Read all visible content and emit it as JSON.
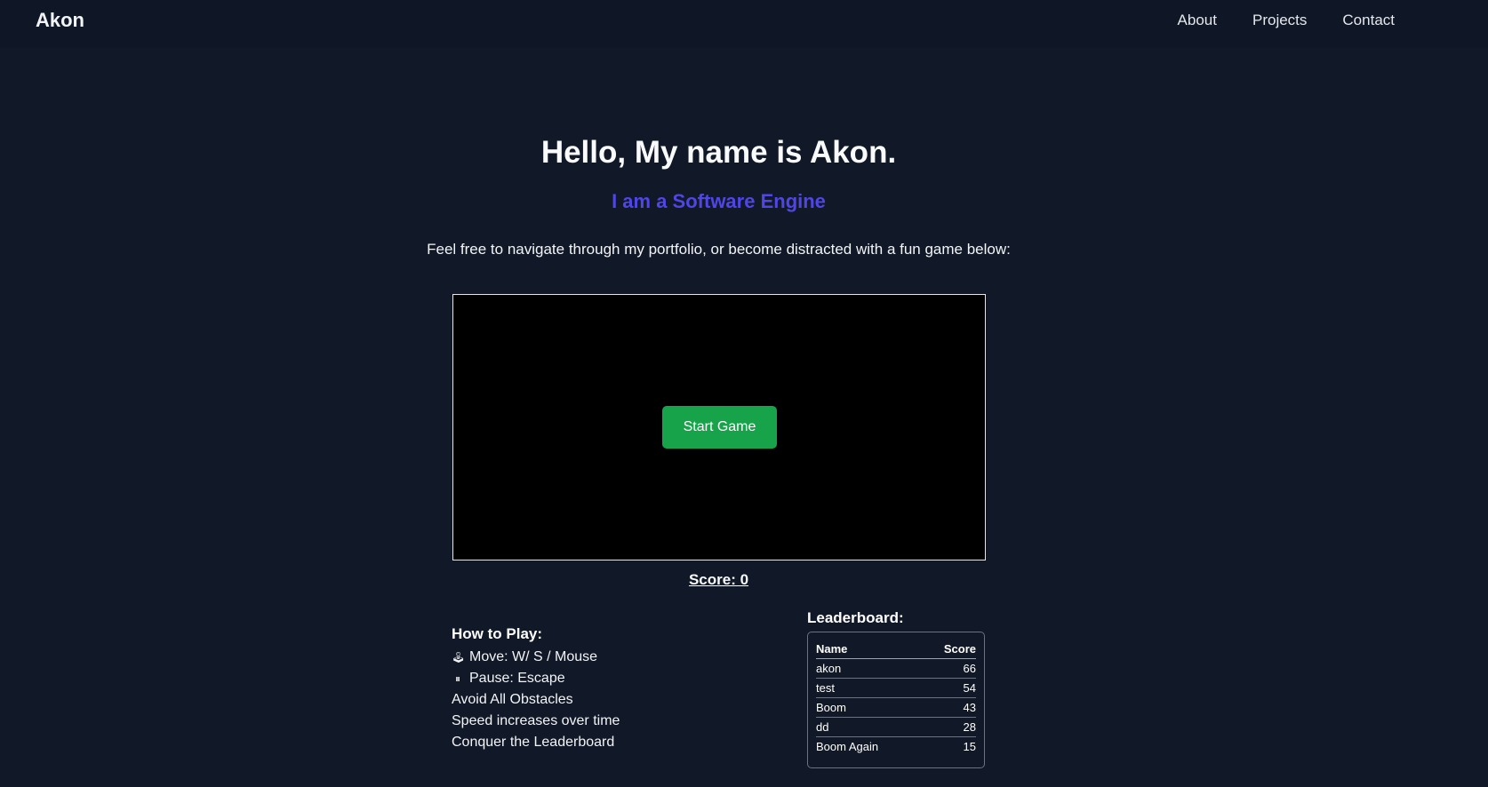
{
  "nav": {
    "brand": "Akon",
    "links": [
      "About",
      "Projects",
      "Contact"
    ]
  },
  "hero": {
    "title": "Hello, My name is Akon.",
    "subtitle": "I am a Software Engine",
    "text": "Feel free to navigate through my portfolio, or become distracted with a fun game below:"
  },
  "game": {
    "start_label": "Start Game",
    "score_text": "Score: 0"
  },
  "howto": {
    "title": "How to Play:",
    "items": [
      {
        "icon": "joystick-icon",
        "glyph": "🕹",
        "text": "Move: W/ S / Mouse"
      },
      {
        "icon": "pause-icon",
        "glyph": "⏸",
        "text": "Pause: Escape"
      },
      {
        "icon": "",
        "glyph": "",
        "text": "Avoid All Obstacles"
      },
      {
        "icon": "",
        "glyph": "",
        "text": "Speed increases over time"
      },
      {
        "icon": "",
        "glyph": "",
        "text": "Conquer the Leaderboard"
      }
    ]
  },
  "leaderboard": {
    "title": "Leaderboard:",
    "headers": {
      "name": "Name",
      "score": "Score"
    },
    "rows": [
      {
        "name": "akon",
        "score": "66"
      },
      {
        "name": "test",
        "score": "54"
      },
      {
        "name": "Boom",
        "score": "43"
      },
      {
        "name": "dd",
        "score": "28"
      },
      {
        "name": "Boom Again",
        "score": "15"
      }
    ]
  },
  "colors": {
    "background": "#111827",
    "navbar": "#0f1726",
    "accent": "#4f46e5",
    "start_button": "#16a34a"
  }
}
